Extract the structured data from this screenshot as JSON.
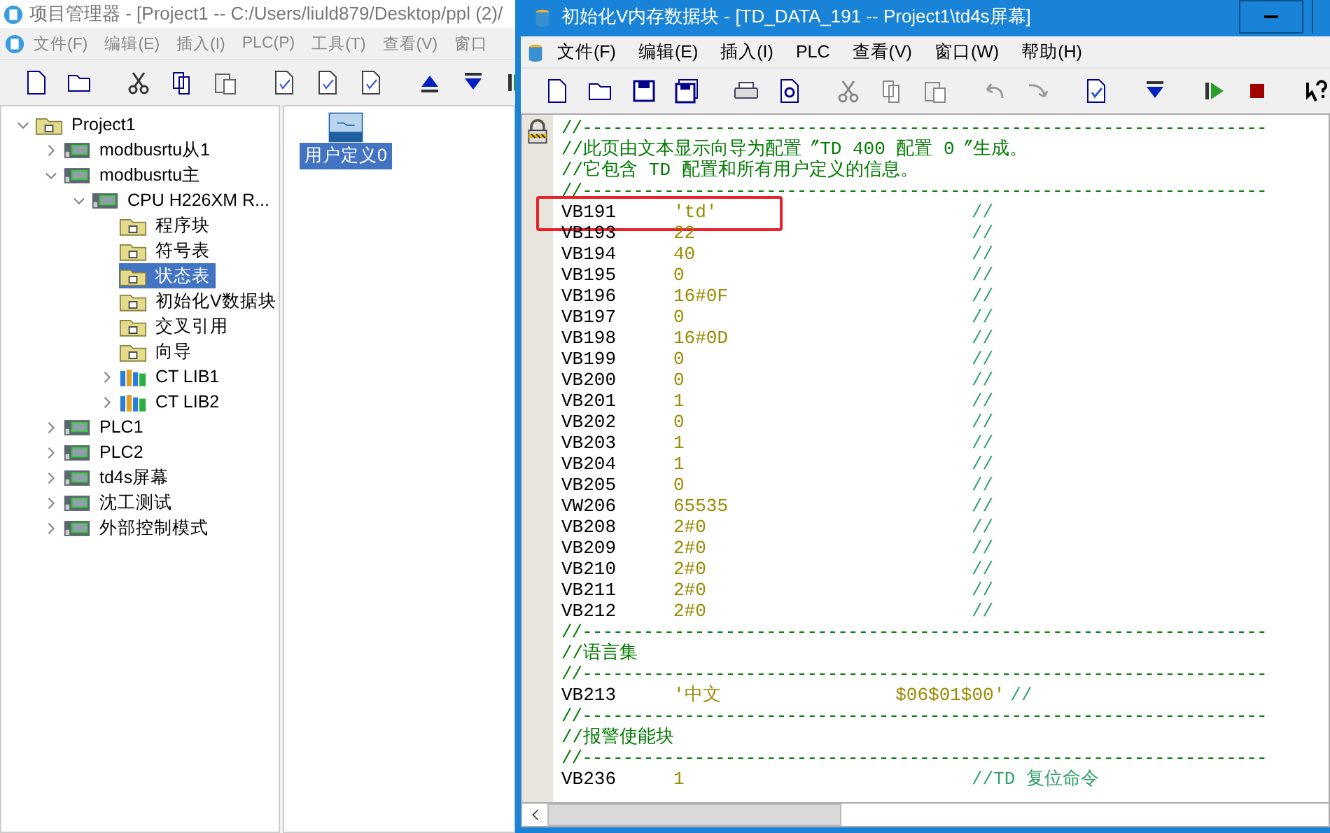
{
  "project_window": {
    "title": "项目管理器 - [Project1 -- C:/Users/liuld879/Desktop/ppl (2)/",
    "menu": [
      "文件(F)",
      "编辑(E)",
      "插入(I)",
      "PLC(P)",
      "工具(T)",
      "查看(V)",
      "窗口"
    ],
    "tree": [
      {
        "label": "Project1",
        "kind": "project",
        "expanded": true,
        "selected": false,
        "children": [
          {
            "label": "modbusrtu从1",
            "kind": "plc",
            "expanded": false,
            "selected": false
          },
          {
            "label": "modbusrtu主",
            "kind": "plc",
            "expanded": true,
            "selected": false,
            "children": [
              {
                "label": "CPU H226XM R...",
                "kind": "plc",
                "expanded": true,
                "selected": false,
                "children": [
                  {
                    "label": "程序块",
                    "kind": "folder",
                    "selected": false
                  },
                  {
                    "label": "符号表",
                    "kind": "folder",
                    "selected": false
                  },
                  {
                    "label": "状态表",
                    "kind": "folder",
                    "selected": true
                  },
                  {
                    "label": "初始化V数据块",
                    "kind": "folder",
                    "selected": false
                  },
                  {
                    "label": "交叉引用",
                    "kind": "folder",
                    "selected": false
                  },
                  {
                    "label": "向导",
                    "kind": "folder",
                    "selected": false
                  },
                  {
                    "label": "CT LIB1",
                    "kind": "library",
                    "expanded": false,
                    "selected": false
                  },
                  {
                    "label": "CT LIB2",
                    "kind": "library",
                    "expanded": false,
                    "selected": false
                  }
                ]
              }
            ]
          },
          {
            "label": "PLC1",
            "kind": "plc",
            "expanded": false,
            "selected": false
          },
          {
            "label": "PLC2",
            "kind": "plc",
            "expanded": false,
            "selected": false
          },
          {
            "label": "td4s屏幕",
            "kind": "plc",
            "expanded": false,
            "selected": false
          },
          {
            "label": "沈工测试",
            "kind": "plc",
            "expanded": false,
            "selected": false
          },
          {
            "label": "外部控制模式",
            "kind": "plc",
            "expanded": false,
            "selected": false
          }
        ]
      }
    ],
    "content_items": [
      {
        "label": "用户定义0",
        "selected": true
      }
    ]
  },
  "editor_window": {
    "title": "初始化V内存数据块 - [TD_DATA_191 -- Project1\\td4s屏幕]",
    "menu": [
      "文件(F)",
      "编辑(E)",
      "插入(I)",
      "PLC",
      "查看(V)",
      "窗口(W)",
      "帮助(H)"
    ],
    "lines": [
      {
        "kind": "rule",
        "text": "//-------------------------------------------------------------------"
      },
      {
        "kind": "comment",
        "text": "//此页由文本显示向导为配置〞TD 400 配置 0〞生成。"
      },
      {
        "kind": "comment",
        "text": "//它包含 TD 配置和所有用户定义的信息。"
      },
      {
        "kind": "rule",
        "text": "//-------------------------------------------------------------------"
      },
      {
        "kind": "data",
        "address": "VB191",
        "value": "'td'",
        "comment": "//",
        "highlighted": true
      },
      {
        "kind": "data",
        "address": "VB193",
        "value": "22",
        "comment": "//",
        "highlighted": false
      },
      {
        "kind": "data",
        "address": "VB194",
        "value": "40",
        "comment": "//",
        "highlighted": false
      },
      {
        "kind": "data",
        "address": "VB195",
        "value": "0",
        "comment": "//",
        "highlighted": false
      },
      {
        "kind": "data",
        "address": "VB196",
        "value": "16#0F",
        "comment": "//",
        "highlighted": false
      },
      {
        "kind": "data",
        "address": "VB197",
        "value": "0",
        "comment": "//",
        "highlighted": false
      },
      {
        "kind": "data",
        "address": "VB198",
        "value": "16#0D",
        "comment": "//",
        "highlighted": false
      },
      {
        "kind": "data",
        "address": "VB199",
        "value": "0",
        "comment": "//",
        "highlighted": false
      },
      {
        "kind": "data",
        "address": "VB200",
        "value": "0",
        "comment": "//",
        "highlighted": false
      },
      {
        "kind": "data",
        "address": "VB201",
        "value": "1",
        "comment": "//",
        "highlighted": false
      },
      {
        "kind": "data",
        "address": "VB202",
        "value": "0",
        "comment": "//",
        "highlighted": false
      },
      {
        "kind": "data",
        "address": "VB203",
        "value": "1",
        "comment": "//",
        "highlighted": false
      },
      {
        "kind": "data",
        "address": "VB204",
        "value": "1",
        "comment": "//",
        "highlighted": false
      },
      {
        "kind": "data",
        "address": "VB205",
        "value": "0",
        "comment": "//",
        "highlighted": false
      },
      {
        "kind": "data",
        "address": "VW206",
        "value": "65535",
        "comment": "//",
        "highlighted": false
      },
      {
        "kind": "data",
        "address": "VB208",
        "value": "2#0",
        "comment": "//",
        "highlighted": false
      },
      {
        "kind": "data",
        "address": "VB209",
        "value": "2#0",
        "comment": "//",
        "highlighted": false
      },
      {
        "kind": "data",
        "address": "VB210",
        "value": "2#0",
        "comment": "//",
        "highlighted": false
      },
      {
        "kind": "data",
        "address": "VB211",
        "value": "2#0",
        "comment": "//",
        "highlighted": false
      },
      {
        "kind": "data",
        "address": "VB212",
        "value": "2#0",
        "comment": "//",
        "highlighted": false
      },
      {
        "kind": "rule",
        "text": "//-------------------------------------------------------------------"
      },
      {
        "kind": "comment",
        "text": "//语言集"
      },
      {
        "kind": "rule",
        "text": "//-------------------------------------------------------------------"
      },
      {
        "kind": "data",
        "address": "VB213",
        "value": "'中文                $06$01$00'",
        "comment": "//",
        "highlighted": false
      },
      {
        "kind": "rule",
        "text": "//-------------------------------------------------------------------"
      },
      {
        "kind": "comment",
        "text": "//报警使能块"
      },
      {
        "kind": "rule",
        "text": "//-------------------------------------------------------------------"
      },
      {
        "kind": "data",
        "address": "VB236",
        "value": "1",
        "comment": "//TD 复位命令",
        "highlighted": false
      }
    ]
  }
}
